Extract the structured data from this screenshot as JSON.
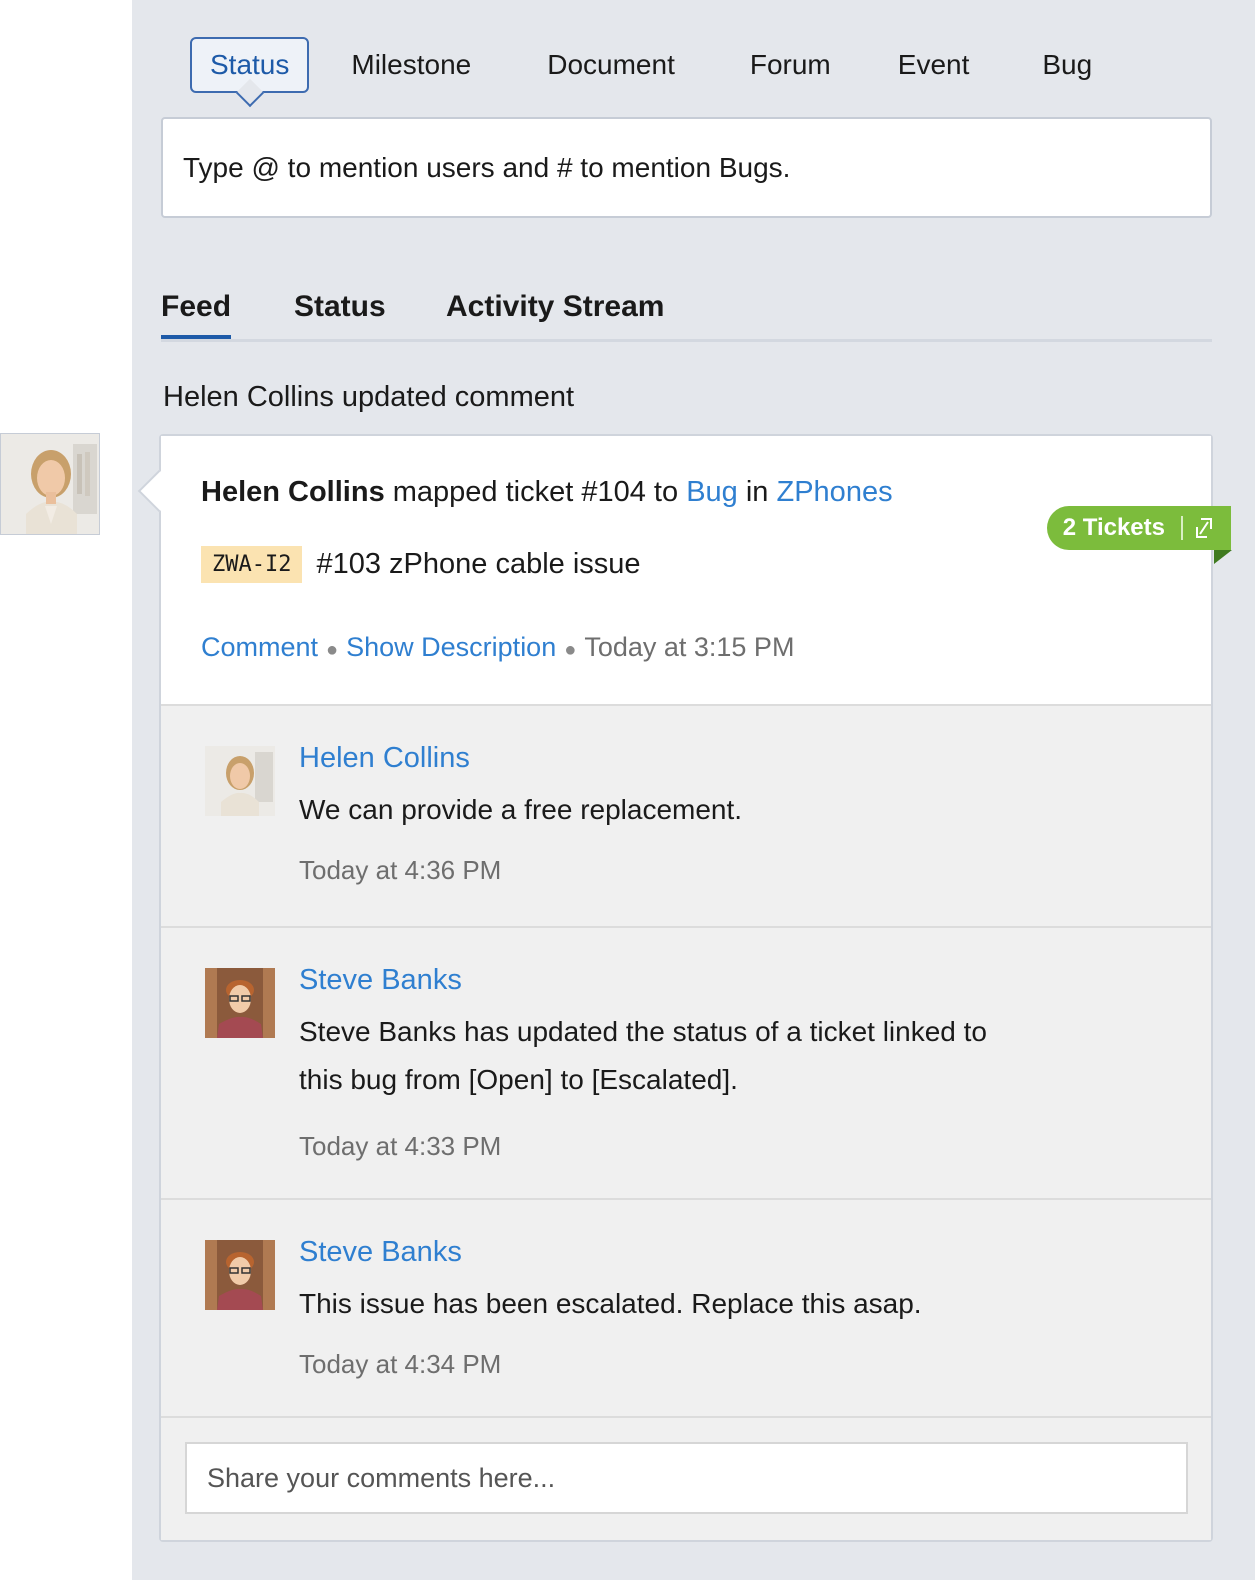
{
  "post_tabs": [
    {
      "label": "Status",
      "active": true
    },
    {
      "label": "Milestone"
    },
    {
      "label": "Document"
    },
    {
      "label": "Forum"
    },
    {
      "label": "Event"
    },
    {
      "label": "Bug"
    }
  ],
  "composer": {
    "placeholder": "Type @ to mention users and # to mention Bugs."
  },
  "feed_tabs": [
    {
      "label": "Feed",
      "active": true
    },
    {
      "label": "Status"
    },
    {
      "label": "Activity Stream"
    }
  ],
  "activity": {
    "title": "Helen Collins updated comment",
    "actor": "Helen Collins",
    "action_text": "mapped ticket #104 to",
    "target_type": "Bug",
    "in_word": "in",
    "project": "ZPhones",
    "ticket_id": "ZWA-I2",
    "ticket_title": "#103 zPhone cable issue",
    "comment_link": "Comment",
    "description_link": "Show Description",
    "time": "Today at 3:15 PM",
    "tickets_badge": "2 Tickets"
  },
  "comments": [
    {
      "author": "Helen Collins",
      "text": "We can provide a free replacement.",
      "time": "Today at 4:36 PM",
      "avatar": "helen"
    },
    {
      "author": "Steve Banks",
      "text": "Steve Banks has updated the status of a ticket linked to this bug from [Open] to [Escalated].",
      "time": "Today at 4:33 PM",
      "avatar": "steve"
    },
    {
      "author": "Steve Banks",
      "text": "This issue has been escalated. Replace this asap.",
      "time": "Today at 4:34 PM",
      "avatar": "steve"
    }
  ],
  "reply": {
    "placeholder": "Share your comments here..."
  },
  "colors": {
    "link": "#2f7fd0",
    "accent": "#1d5aa8",
    "badge": "#7cbc3c",
    "ticket_tag": "#fbe3b1"
  }
}
